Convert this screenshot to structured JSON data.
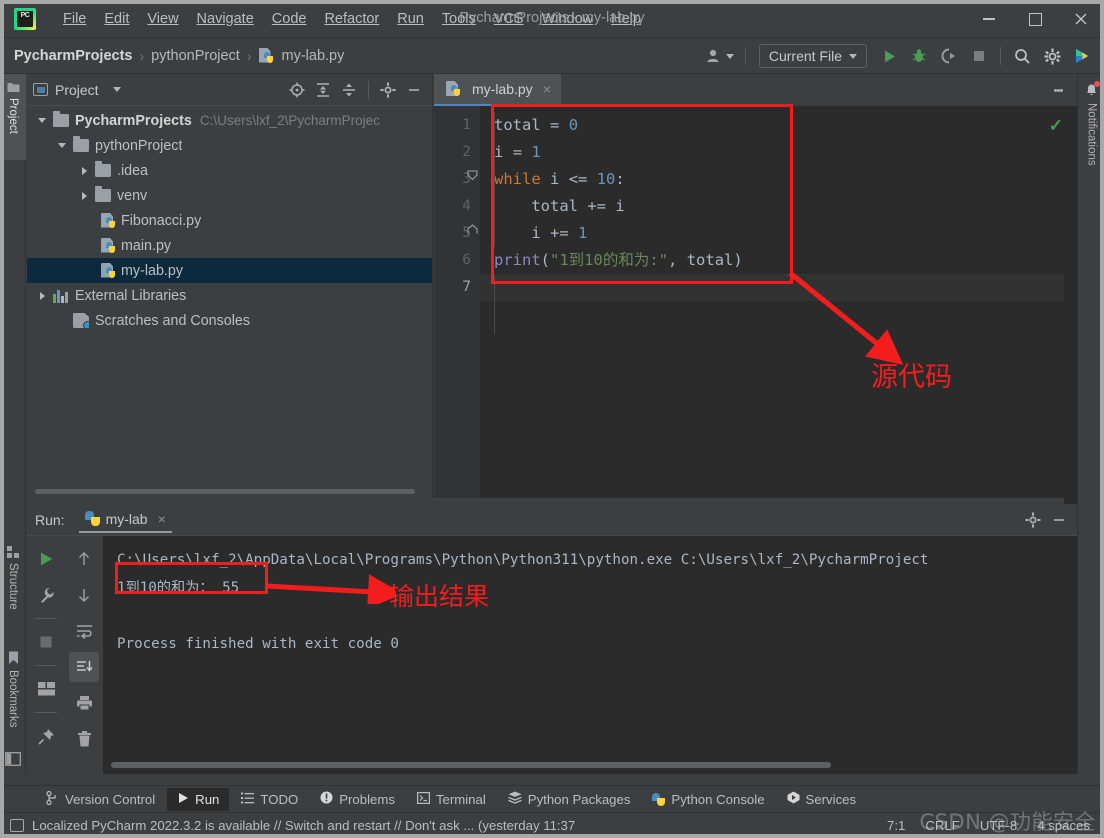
{
  "titlebar": {
    "logo_text": "PC",
    "menus": [
      "File",
      "Edit",
      "View",
      "Navigate",
      "Code",
      "Refactor",
      "Run",
      "Tools",
      "VCS",
      "Window",
      "Help"
    ],
    "window_title": "PycharmProjects - my-lab.py",
    "minimize_icon": "minimize-icon",
    "maximize_icon": "maximize-icon",
    "close_icon": "close-icon"
  },
  "navbar": {
    "breadcrumb": [
      "PycharmProjects",
      "pythonProject",
      "my-lab.py"
    ],
    "separator": "›",
    "run_config": "Current File",
    "icons": [
      "user-icon",
      "run-icon",
      "debug-icon",
      "coverage-icon",
      "stop-icon",
      "search-icon",
      "settings-icon",
      "ai-assistant-icon"
    ]
  },
  "left_strip": {
    "project_tab": "Project",
    "structure_tab": "Structure",
    "bookmarks_tab": "Bookmarks"
  },
  "right_strip": {
    "notifications_tab": "Notifications"
  },
  "project_panel": {
    "title": "Project",
    "toolbar_icons": [
      "locate-icon",
      "expand-all-icon",
      "collapse-all-icon",
      "settings-icon",
      "hide-icon"
    ],
    "tree": [
      {
        "label": "PycharmProjects",
        "hint": "C:\\Users\\lxf_2\\PycharmProjec",
        "indent": 0,
        "arrow": "down",
        "icon": "folder-icon",
        "bold": true,
        "selected": false
      },
      {
        "label": "pythonProject",
        "hint": "",
        "indent": 1,
        "arrow": "down",
        "icon": "folder-icon",
        "bold": false,
        "selected": false
      },
      {
        "label": ".idea",
        "hint": "",
        "indent": 2,
        "arrow": "right",
        "icon": "folder-icon",
        "bold": false,
        "selected": false
      },
      {
        "label": "venv",
        "hint": "",
        "indent": 2,
        "arrow": "right",
        "icon": "folder-icon",
        "bold": false,
        "selected": false
      },
      {
        "label": "Fibonacci.py",
        "hint": "",
        "indent": 3,
        "arrow": "none",
        "icon": "python-file-icon",
        "bold": false,
        "selected": false
      },
      {
        "label": "main.py",
        "hint": "",
        "indent": 3,
        "arrow": "none",
        "icon": "python-file-icon",
        "bold": false,
        "selected": false
      },
      {
        "label": "my-lab.py",
        "hint": "",
        "indent": 3,
        "arrow": "none",
        "icon": "python-file-icon",
        "bold": false,
        "selected": true
      },
      {
        "label": "External Libraries",
        "hint": "",
        "indent": 0,
        "arrow": "right",
        "icon": "libraries-icon",
        "bold": false,
        "selected": false
      },
      {
        "label": "Scratches and Consoles",
        "hint": "",
        "indent": 1,
        "arrow": "none",
        "icon": "scratches-icon",
        "bold": false,
        "selected": false
      }
    ]
  },
  "editor": {
    "tab_label": "my-lab.py",
    "tab_close": "×",
    "inspection_status": "✓",
    "line_numbers": [
      "1",
      "2",
      "3",
      "4",
      "5",
      "6",
      "7"
    ],
    "code_lines": [
      {
        "n": 1,
        "text": "total = 0"
      },
      {
        "n": 2,
        "text": "i = 1"
      },
      {
        "n": 3,
        "text": "while i <= 10:"
      },
      {
        "n": 4,
        "text": "    total += i"
      },
      {
        "n": 5,
        "text": "    i += 1"
      },
      {
        "n": 6,
        "text": "print(\"1到10的和为:\", total)"
      },
      {
        "n": 7,
        "text": ""
      }
    ],
    "tokens": {
      "total": "total",
      "eq": "=",
      "zero": "0",
      "i": "i",
      "one": "1",
      "while": "while",
      "lte": "<=",
      "ten": "10",
      "colon": ":",
      "pluseq": "+=",
      "print": "print",
      "lparen": "(",
      "string": "\"1到10的和为:\"",
      "comma": ",",
      "rparen": ")"
    }
  },
  "run_panel": {
    "label": "Run:",
    "tab_name": "my-lab",
    "tab_close": "×",
    "header_icons": [
      "settings-icon",
      "hide-icon"
    ],
    "side_icons_left": [
      "rerun-icon",
      "wrench-icon",
      "stop-icon",
      "layout-icon",
      "pin-icon"
    ],
    "side_icons_right": [
      "up-icon",
      "down-icon",
      "soft-wrap-icon",
      "scroll-to-end-icon",
      "print-icon",
      "trash-icon"
    ],
    "console_lines": [
      "C:\\Users\\lxf_2\\AppData\\Local\\Programs\\Python\\Python311\\python.exe C:\\Users\\lxf_2\\PycharmProject",
      "1到10的和为： 55",
      "",
      "Process finished with exit code 0"
    ]
  },
  "toolwindow_bar": {
    "items": [
      {
        "label": "Version Control",
        "icon": "branch-icon",
        "active": false
      },
      {
        "label": "Run",
        "icon": "run-icon",
        "active": true
      },
      {
        "label": "TODO",
        "icon": "todo-icon",
        "active": false
      },
      {
        "label": "Problems",
        "icon": "problems-icon",
        "active": false
      },
      {
        "label": "Terminal",
        "icon": "terminal-icon",
        "active": false
      },
      {
        "label": "Python Packages",
        "icon": "packages-icon",
        "active": false
      },
      {
        "label": "Python Console",
        "icon": "python-icon",
        "active": false
      },
      {
        "label": "Services",
        "icon": "services-icon",
        "active": false
      }
    ]
  },
  "status_bar": {
    "message": "Localized PyCharm 2022.3.2 is available // Switch and restart // Don't ask ... (yesterday 11:37",
    "caret_position": "7:1",
    "line_separator": "CRLF",
    "encoding": "UTF-8",
    "indent": "4 spaces"
  },
  "annotations": {
    "source_code_label": "源代码",
    "output_label": "输出结果",
    "box_color": "#f41d1d"
  },
  "watermark": "CSDN @功能安全"
}
